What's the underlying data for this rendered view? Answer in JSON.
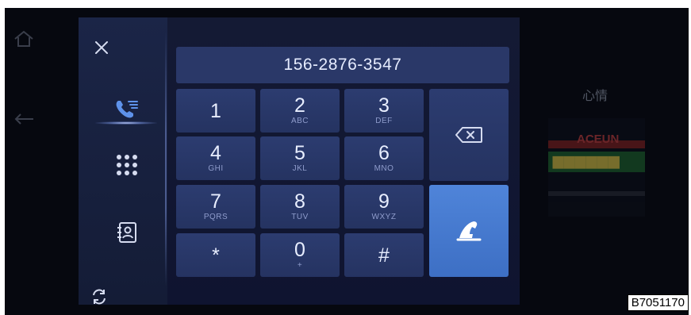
{
  "dialer": {
    "number": "156-2876-3547",
    "keys": [
      {
        "digit": "1",
        "letters": ""
      },
      {
        "digit": "2",
        "letters": "ABC"
      },
      {
        "digit": "3",
        "letters": "DEF"
      },
      {
        "digit": "4",
        "letters": "GHI"
      },
      {
        "digit": "5",
        "letters": "JKL"
      },
      {
        "digit": "6",
        "letters": "MNO"
      },
      {
        "digit": "7",
        "letters": "PQRS"
      },
      {
        "digit": "8",
        "letters": "TUV"
      },
      {
        "digit": "9",
        "letters": "WXYZ"
      },
      {
        "digit": "*",
        "letters": ""
      },
      {
        "digit": "0",
        "letters": "+"
      },
      {
        "digit": "#",
        "letters": ""
      }
    ]
  },
  "nav": {
    "items": [
      {
        "icon": "call-log-icon"
      },
      {
        "icon": "keypad-icon",
        "active": true
      },
      {
        "icon": "contacts-icon"
      },
      {
        "icon": "sync-icon"
      }
    ]
  },
  "background": {
    "label": "心情"
  },
  "figure_code": "B7051170",
  "colors": {
    "accent": "#4a7fd6",
    "key_bg": "#2a3a6d",
    "panel_bg": "#1a2444"
  }
}
